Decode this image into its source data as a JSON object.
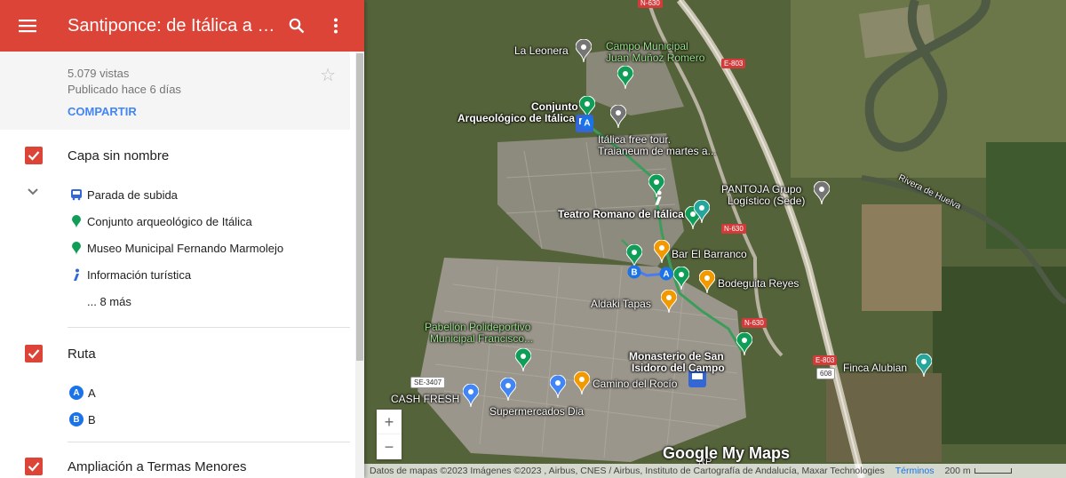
{
  "header": {
    "title": "Santiponce: de Itálica a S...",
    "menu_icon": "menu-icon",
    "search_icon": "search-icon",
    "more_icon": "more-vert-icon"
  },
  "info": {
    "views": "5.079 vistas",
    "published": "Publicado hace 6 días",
    "share_label": "COMPARTIR"
  },
  "layers": [
    {
      "title": "Capa sin nombre",
      "items": [
        {
          "label": "Parada de subida",
          "icon": "bus-icon"
        },
        {
          "label": "Conjunto arqueológico de Itálica",
          "icon": "green-pin-icon"
        },
        {
          "label": "Museo Municipal Fernando Marmolejo",
          "icon": "green-pin-icon"
        },
        {
          "label": "Información turística",
          "icon": "info-icon"
        }
      ],
      "more": "... 8 más"
    },
    {
      "title": "Ruta",
      "items": [
        {
          "badge": "A",
          "label": "A"
        },
        {
          "badge": "B",
          "label": "B"
        }
      ]
    },
    {
      "title": "Ampliación a Termas Menores"
    }
  ],
  "map": {
    "labels": {
      "leonera": "La Leonera",
      "campo1": "Campo Municipal",
      "campo2": "Juan Muñoz Romero",
      "conjunto1": "Conjunto",
      "conjunto2": "Arqueológico de Itálica",
      "freetour1": "Itálica free tour.",
      "freetour2": "Traianeum de martes a...",
      "pantoja1": "PANTOJA Grupo",
      "pantoja2": "Logístico (Sede)",
      "teatro": "Teatro Romano de Itálica",
      "barranco": "Bar El Barranco",
      "bodeguita": "Bodeguita Reyes",
      "aldaki": "Aldaki Tapas",
      "pabellon1": "Pabellón Polideportivo",
      "pabellon2": "Municipal Francisco...",
      "monasterio1": "Monasterio de San",
      "monasterio2": "Isidoro del Campo",
      "finca": "Finca Alubian",
      "cashfresh": "CASH FRESH",
      "camino": "Camino del Rocío",
      "dia": "Supermercados Dia",
      "rivera": "Rivera de Huelva",
      "rp": "RP"
    },
    "shields": {
      "n630a": "N-630",
      "e803a": "E-803",
      "n630b": "N-630",
      "n630c": "N-630",
      "e803b": "E-803",
      "s608": "608",
      "se3407": "SE-3407"
    },
    "zoom_in": "+",
    "zoom_out": "−",
    "logo": "Google My Maps",
    "attribution": "Datos de mapas ©2023 Imágenes ©2023 , Airbus, CNES / Airbus, Instituto de Cartografía de Andalucía, Maxar Technologies",
    "terms": "Términos",
    "scale": "200 m"
  },
  "colors": {
    "header": "#db4437",
    "link": "#4285f4",
    "route": "#3c9d5a",
    "route_alt": "#4a7cf0",
    "pin_green": "#0f9d58",
    "pin_gray": "#757575",
    "pin_orange": "#f29900",
    "pin_blue": "#4285f4"
  }
}
